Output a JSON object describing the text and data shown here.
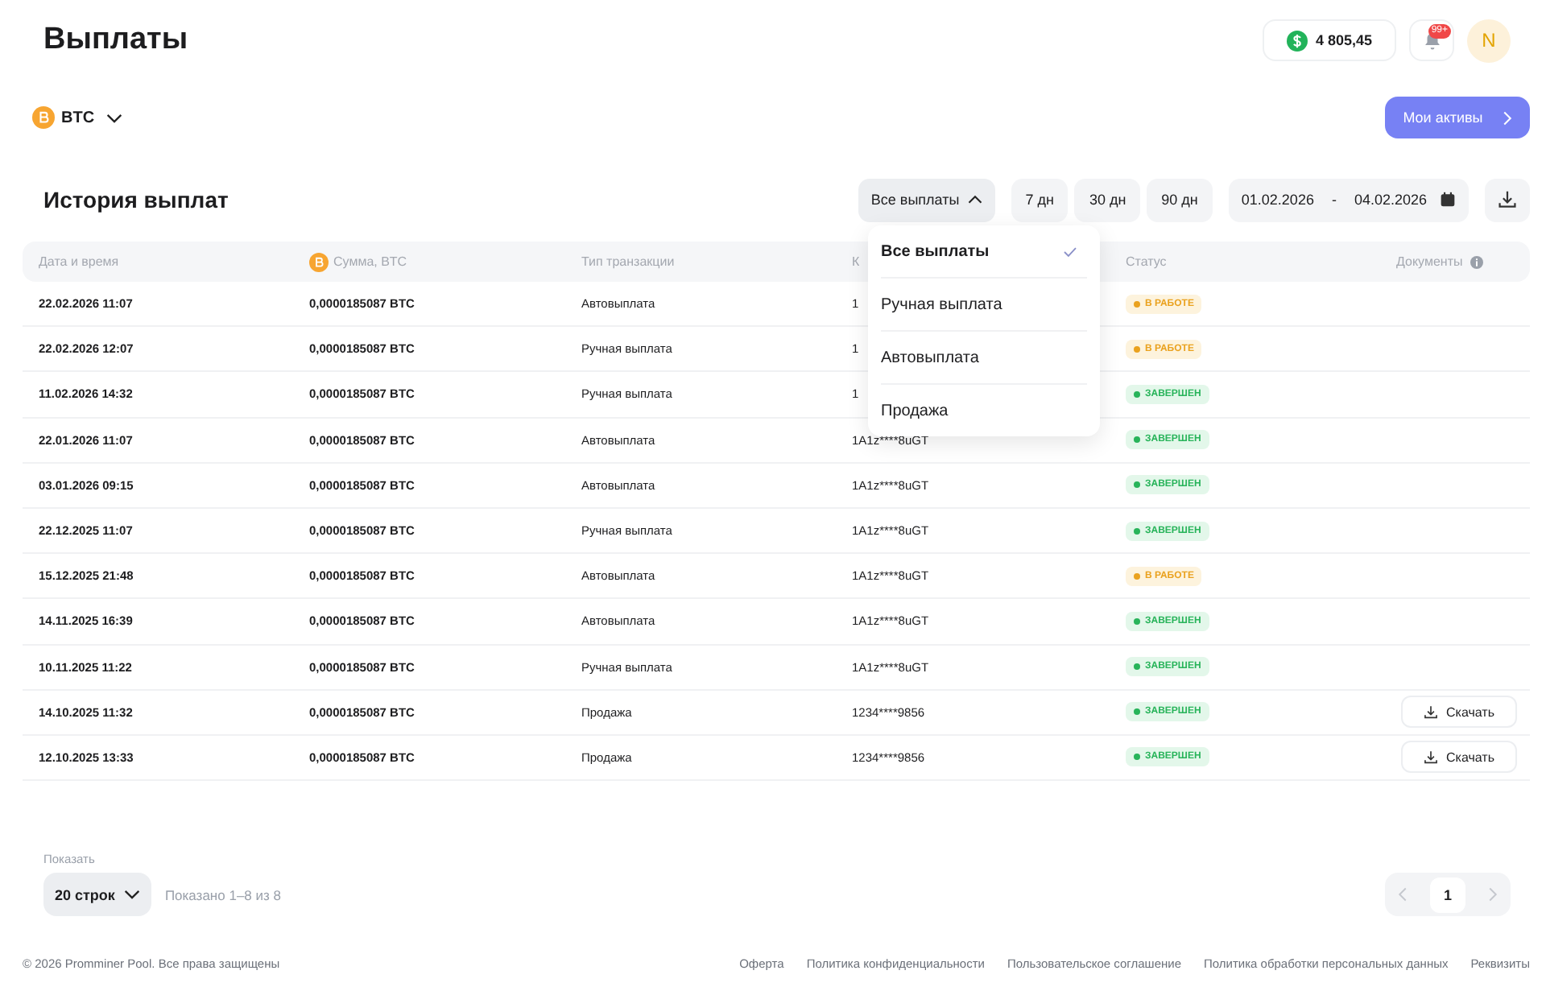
{
  "page_title": "Выплаты",
  "balance": "4 805,45",
  "notifications_badge": "99+",
  "avatar_letter": "N",
  "currency_selector": "BTC",
  "assets_button": "Мои активы",
  "history": {
    "title": "История выплат",
    "filter": {
      "label": "Все выплаты",
      "expanded": true,
      "options": [
        {
          "label": "Все выплаты",
          "selected": true
        },
        {
          "label": "Ручная выплата",
          "selected": false
        },
        {
          "label": "Автовыплата",
          "selected": false
        },
        {
          "label": "Продажа",
          "selected": false
        }
      ]
    },
    "periods": [
      {
        "label": "7 дн",
        "selected": false
      },
      {
        "label": "30 дн",
        "selected": false
      },
      {
        "label": "90 дн",
        "selected": false
      }
    ],
    "date_from": "01.02.2026",
    "date_separator": "-",
    "date_to": "04.02.2026"
  },
  "table": {
    "columns": [
      "Дата и время",
      "Сумма, BTC",
      "Тип транзакции",
      "К",
      "Статус",
      "Документы"
    ],
    "rows": [
      {
        "date": "22.02.2026 11:07",
        "amount": "0,0000185087 BTC",
        "type": "Автовыплата",
        "address": "1",
        "status": {
          "kind": "in_progress",
          "label": "В РАБОТЕ"
        }
      },
      {
        "date": "22.02.2026 12:07",
        "amount": "0,0000185087 BTC",
        "type": "Ручная выплата",
        "address": "1",
        "status": {
          "kind": "in_progress",
          "label": "В РАБОТЕ"
        }
      },
      {
        "date": "11.02.2026 14:32",
        "amount": "0,0000185087 BTC",
        "type": "Ручная выплата",
        "address": "1",
        "status": {
          "kind": "done",
          "label": "ЗАВЕРШЕН"
        }
      },
      {
        "date": "22.01.2026 11:07",
        "amount": "0,0000185087 BTC",
        "type": "Автовыплата",
        "address": "1A1z****8uGT",
        "status": {
          "kind": "done",
          "label": "ЗАВЕРШЕН"
        }
      },
      {
        "date": "03.01.2026 09:15",
        "amount": "0,0000185087 BTC",
        "type": "Автовыплата",
        "address": "1A1z****8uGT",
        "status": {
          "kind": "done",
          "label": "ЗАВЕРШЕН"
        }
      },
      {
        "date": "22.12.2025 11:07",
        "amount": "0,0000185087 BTC",
        "type": "Ручная выплата",
        "address": "1A1z****8uGT",
        "status": {
          "kind": "done",
          "label": "ЗАВЕРШЕН"
        }
      },
      {
        "date": "15.12.2025 21:48",
        "amount": "0,0000185087 BTC",
        "type": "Автовыплата",
        "address": "1A1z****8uGT",
        "status": {
          "kind": "in_progress",
          "label": "В РАБОТЕ"
        }
      },
      {
        "date": "14.11.2025 16:39",
        "amount": "0,0000185087 BTC",
        "type": "Автовыплата",
        "address": "1A1z****8uGT",
        "status": {
          "kind": "done",
          "label": "ЗАВЕРШЕН"
        }
      },
      {
        "date": "10.11.2025 11:22",
        "amount": "0,0000185087 BTC",
        "type": "Ручная выплата",
        "address": "1A1z****8uGT",
        "status": {
          "kind": "done",
          "label": "ЗАВЕРШЕН"
        }
      },
      {
        "date": "14.10.2025 11:32",
        "amount": "0,0000185087 BTC",
        "type": "Продажа",
        "address": "1234****9856",
        "status": {
          "kind": "done",
          "label": "ЗАВЕРШЕН"
        },
        "document": "Скачать"
      },
      {
        "date": "12.10.2025 13:33",
        "amount": "0,0000185087 BTC",
        "type": "Продажа",
        "address": "1234****9856",
        "status": {
          "kind": "done",
          "label": "ЗАВЕРШЕН"
        },
        "document": "Скачать"
      }
    ]
  },
  "pagination": {
    "show_label": "Показать",
    "page_size": "20 строк",
    "shown": "Показано 1–8 из 8",
    "pages": [
      {
        "label": "1",
        "selected": true
      }
    ]
  },
  "footer": {
    "copyright": "© 2026 Promminer Pool. Все права защищены",
    "links": [
      "Оферта",
      "Политика конфиденциальности",
      "Пользовательское соглашение",
      "Политика обработки персональных данных",
      "Реквизиты"
    ]
  }
}
